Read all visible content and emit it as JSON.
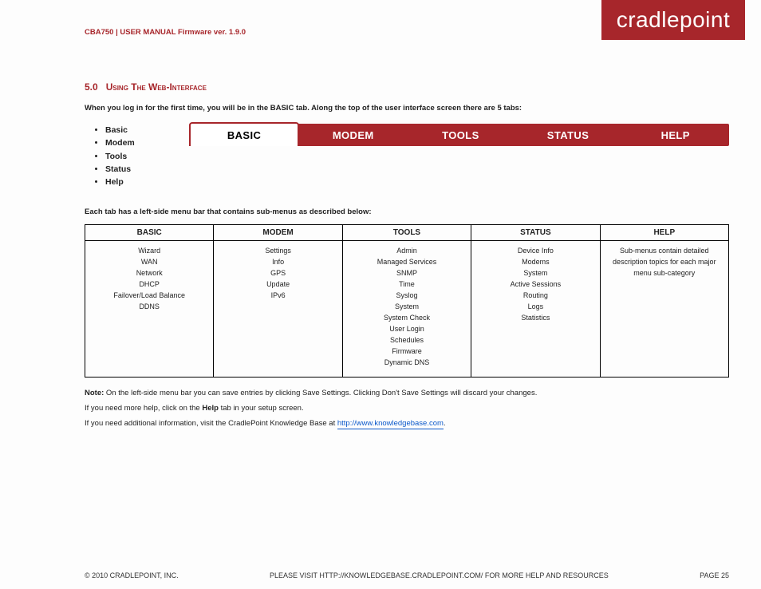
{
  "brand": {
    "logoText": "cradlepoint"
  },
  "header": {
    "docLine": "CBA750 | USER MANUAL Firmware ver. 1.9.0"
  },
  "section": {
    "num": "5.0",
    "title": "Using The Web-Interface",
    "intro": "When you log in for the first time, you will be in the BASIC tab. Along the top of the user interface screen there are 5 tabs:",
    "bullets": [
      "Basic",
      "Modem",
      "Tools",
      "Status",
      "Help"
    ],
    "sidebarNote": "Each tab has a left-side menu bar that contains sub-menus as described below:"
  },
  "tabs": [
    {
      "label": "BASIC",
      "active": true
    },
    {
      "label": "MODEM",
      "active": false
    },
    {
      "label": "TOOLS",
      "active": false
    },
    {
      "label": "STATUS",
      "active": false
    },
    {
      "label": "HELP",
      "active": false
    }
  ],
  "table": {
    "headers": [
      "BASIC",
      "MODEM",
      "TOOLS",
      "STATUS",
      "HELP"
    ],
    "rows": [
      [
        "Wizard\nWAN\nNetwork\nDHCP\nFailover/Load Balance\nDDNS",
        "Settings\nInfo\nGPS\nUpdate\nIPv6",
        "Admin\nManaged Services\nSNMP\nTime\nSyslog\nSystem\nSystem Check\nUser Login\nSchedules\nFirmware\nDynamic DNS",
        "Device Info\nModems\nSystem\nActive Sessions\nRouting\nLogs\nStatistics",
        "Sub-menus contain detailed description topics for each major menu sub-category"
      ]
    ]
  },
  "footer": {
    "p1_bold": "Note:",
    "p1_rest": " On the left-side menu bar you can save entries by clicking Save Settings. Clicking Don't Save Settings will discard your changes.",
    "p2_prefix": "If you need more help, click on the ",
    "p2_bold": "Help",
    "p2_suffix": " tab in your setup screen.",
    "p3_prefix": "If you need additional information, visit the CradlePoint Knowledge Base at ",
    "p3_link": "http://www.knowledgebase.com",
    "p3_suffix": "."
  },
  "pageFooter": {
    "left": "© 2010 CRADLEPOINT, INC.",
    "right": "PLEASE VISIT HTTP://KNOWLEDGEBASE.CRADLEPOINT.COM/ FOR MORE HELP AND RESOURCES",
    "page": "PAGE 25"
  }
}
